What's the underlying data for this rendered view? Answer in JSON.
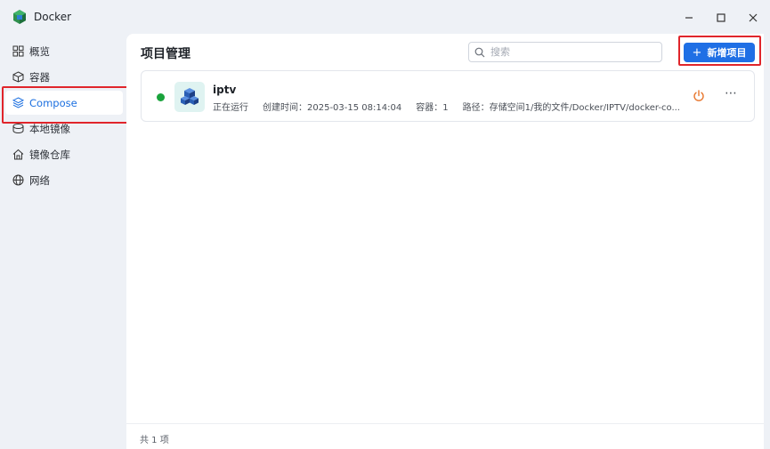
{
  "window": {
    "title": "Docker",
    "minimize_icon": "minimize-icon",
    "maximize_icon": "maximize-icon",
    "close_icon": "close-icon"
  },
  "sidebar": {
    "items": [
      {
        "label": "概览",
        "icon": "grid-icon"
      },
      {
        "label": "容器",
        "icon": "cube-icon"
      },
      {
        "label": "Compose",
        "icon": "layers-icon",
        "active": true
      },
      {
        "label": "本地镜像",
        "icon": "drive-icon"
      },
      {
        "label": "镜像仓库",
        "icon": "house-icon"
      },
      {
        "label": "网络",
        "icon": "globe-icon"
      }
    ]
  },
  "main": {
    "title": "项目管理",
    "search": {
      "placeholder": "搜索",
      "value": ""
    },
    "add_button": "新增项目",
    "projects": [
      {
        "name": "iptv",
        "status": "正在运行",
        "created": "创建时间：2025-03-15 08:14:04",
        "containers": "容器：1",
        "path": "路径：存储空间1/我的文件/Docker/IPTV/docker-co..."
      }
    ],
    "footer": "共 1 项"
  },
  "colors": {
    "accent": "#1f6fe5",
    "running": "#1aa33c",
    "power": "#e8772e",
    "highlight": "#e0252b"
  }
}
